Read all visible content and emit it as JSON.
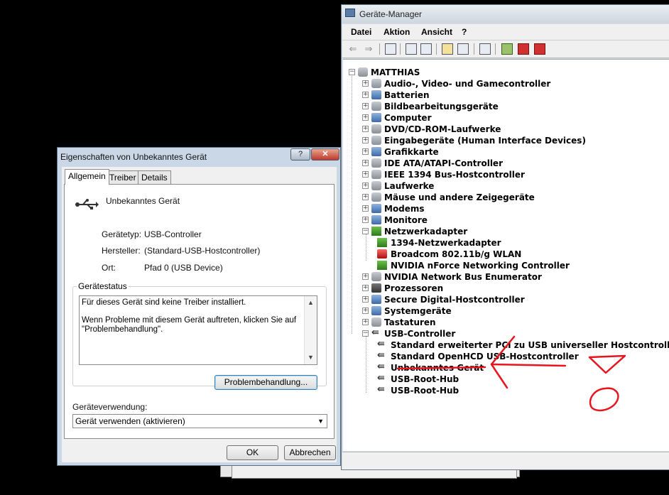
{
  "devmgr": {
    "title": "Geräte-Manager",
    "menu": [
      "Datei",
      "Aktion",
      "Ansicht",
      "?"
    ],
    "tree": [
      {
        "label": "MATTHIAS",
        "level": 0,
        "expander": "−",
        "icon": "computer-icon",
        "color": "gray"
      },
      {
        "label": "Audio-, Video- und Gamecontroller",
        "level": 1,
        "expander": "+",
        "icon": "speaker-icon",
        "color": "gray"
      },
      {
        "label": "Batterien",
        "level": 1,
        "expander": "+",
        "icon": "battery-icon",
        "color": "blue"
      },
      {
        "label": "Bildbearbeitungsgeräte",
        "level": 1,
        "expander": "+",
        "icon": "camera-icon",
        "color": "gray"
      },
      {
        "label": "Computer",
        "level": 1,
        "expander": "+",
        "icon": "computer-icon",
        "color": "blue"
      },
      {
        "label": "DVD/CD-ROM-Laufwerke",
        "level": 1,
        "expander": "+",
        "icon": "disc-icon",
        "color": "gray"
      },
      {
        "label": "Eingabegeräte (Human Interface Devices)",
        "level": 1,
        "expander": "+",
        "icon": "keyboard-icon",
        "color": "gray"
      },
      {
        "label": "Grafikkarte",
        "level": 1,
        "expander": "+",
        "icon": "display-adapter-icon",
        "color": "blue"
      },
      {
        "label": "IDE ATA/ATAPI-Controller",
        "level": 1,
        "expander": "+",
        "icon": "ide-controller-icon",
        "color": "gray"
      },
      {
        "label": "IEEE 1394 Bus-Hostcontroller",
        "level": 1,
        "expander": "+",
        "icon": "firewire-icon",
        "color": "gray"
      },
      {
        "label": "Laufwerke",
        "level": 1,
        "expander": "+",
        "icon": "drive-icon",
        "color": "gray"
      },
      {
        "label": "Mäuse und andere Zeigegeräte",
        "level": 1,
        "expander": "+",
        "icon": "mouse-icon",
        "color": "gray"
      },
      {
        "label": "Modems",
        "level": 1,
        "expander": "+",
        "icon": "modem-icon",
        "color": "blue"
      },
      {
        "label": "Monitore",
        "level": 1,
        "expander": "+",
        "icon": "monitor-icon",
        "color": "blue"
      },
      {
        "label": "Netzwerkadapter",
        "level": 1,
        "expander": "−",
        "icon": "network-adapter-icon",
        "color": "green"
      },
      {
        "label": "1394-Netzwerkadapter",
        "level": 2,
        "expander": "",
        "icon": "network-adapter-icon",
        "color": "green"
      },
      {
        "label": "Broadcom 802.11b/g WLAN",
        "level": 2,
        "expander": "",
        "icon": "network-adapter-icon",
        "color": "red"
      },
      {
        "label": "NVIDIA nForce Networking Controller",
        "level": 2,
        "expander": "",
        "icon": "network-adapter-icon",
        "color": "green"
      },
      {
        "label": "NVIDIA Network Bus Enumerator",
        "level": 1,
        "expander": "+",
        "icon": "bus-enumerator-icon",
        "color": "gray"
      },
      {
        "label": "Prozessoren",
        "level": 1,
        "expander": "+",
        "icon": "processor-icon",
        "color": "dark"
      },
      {
        "label": "Secure Digital-Hostcontroller",
        "level": 1,
        "expander": "+",
        "icon": "sd-card-icon",
        "color": "blue"
      },
      {
        "label": "Systemgeräte",
        "level": 1,
        "expander": "+",
        "icon": "system-device-icon",
        "color": "blue"
      },
      {
        "label": "Tastaturen",
        "level": 1,
        "expander": "+",
        "icon": "keyboard-icon",
        "color": "gray"
      },
      {
        "label": "USB-Controller",
        "level": 1,
        "expander": "−",
        "icon": "usb-icon",
        "color": "usb"
      },
      {
        "label": "Standard erweiterter PCI zu USB universeller Hostcontroller",
        "level": 2,
        "expander": "",
        "icon": "usb-icon",
        "color": "usb"
      },
      {
        "label": "Standard OpenHCD USB-Hostcontroller",
        "level": 2,
        "expander": "",
        "icon": "usb-icon",
        "color": "usb"
      },
      {
        "label": "Unbekanntes Gerät",
        "level": 2,
        "expander": "",
        "icon": "usb-icon",
        "color": "usb"
      },
      {
        "label": "USB-Root-Hub",
        "level": 2,
        "expander": "",
        "icon": "usb-icon",
        "color": "usb"
      },
      {
        "label": "USB-Root-Hub",
        "level": 2,
        "expander": "",
        "icon": "usb-icon",
        "color": "usb"
      }
    ]
  },
  "props": {
    "title": "Eigenschaften von Unbekanntes Gerät",
    "help_label": "?",
    "close_label": "✕",
    "tabs": [
      "Allgemein",
      "Treiber",
      "Details"
    ],
    "device_name": "Unbekanntes Gerät",
    "fields": [
      {
        "label": "Gerätetyp:",
        "value": "USB-Controller"
      },
      {
        "label": "Hersteller:",
        "value": "(Standard-USB-Hostcontroller)"
      },
      {
        "label": "Ort:",
        "value": "Pfad 0 (USB Device)"
      }
    ],
    "status_title": "Gerätestatus",
    "status_line1": "Für dieses Gerät sind keine Treiber installiert.",
    "status_line2": "Wenn Probleme mit diesem Gerät auftreten, klicken Sie auf\n\"Problembehandlung\".",
    "troubleshoot_label": "Problembehandlung...",
    "usage_label": "Geräteverwendung:",
    "usage_value": "Gerät verwenden (aktivieren)",
    "ok_label": "OK",
    "cancel_label": "Abbrechen"
  },
  "colors": {
    "annotation": "#e8141e",
    "window_frame": "#c9d7e6"
  }
}
